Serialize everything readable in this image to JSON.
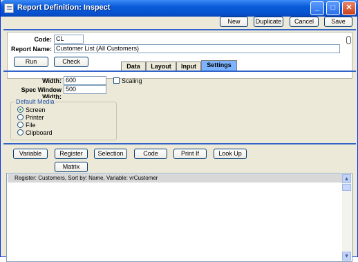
{
  "window": {
    "title": "Report Definition: Inspect"
  },
  "toolbar": {
    "new": "New",
    "duplicate": "Duplicate",
    "cancel": "Cancel",
    "save": "Save"
  },
  "header": {
    "code_label": "Code:",
    "code_value": "CL",
    "report_name_label": "Report Name:",
    "report_name_value": "Customer List (All Customers)"
  },
  "actions": {
    "run": "Run",
    "check": "Check"
  },
  "tabs": [
    {
      "label": "Data",
      "active": false
    },
    {
      "label": "Layout",
      "active": false
    },
    {
      "label": "Input",
      "active": false
    },
    {
      "label": "Settings",
      "active": true
    }
  ],
  "settings": {
    "width_label": "Width:",
    "width_value": "600",
    "scaling_label": "Scaling",
    "scaling_checked": false,
    "spec_width_label": "Spec Window Width:",
    "spec_width_value": "500",
    "media_group_title": "Default Media",
    "media_options": [
      {
        "label": "Screen",
        "selected": true
      },
      {
        "label": "Printer",
        "selected": false
      },
      {
        "label": "File",
        "selected": false
      },
      {
        "label": "Clipboard",
        "selected": false
      }
    ]
  },
  "insert_buttons": {
    "variable": "Variable",
    "register": "Register",
    "selection": "Selection",
    "code": "Code",
    "print_if": "Print If",
    "look_up": "Look Up",
    "matrix": "Matrix"
  },
  "spec_lines": [
    "Register: Customers, Sort by: Name, Variable: vrCustomer"
  ],
  "colors": {
    "title_bar": "#0a5bd8",
    "active_tab": "#7eb4ff",
    "separator": "#3163c9",
    "group_title": "#1f4ea5"
  }
}
